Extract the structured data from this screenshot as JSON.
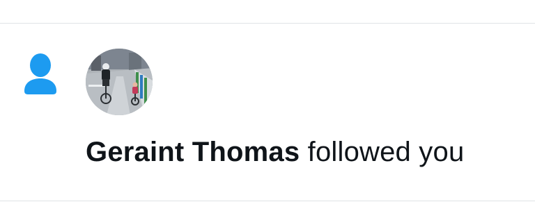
{
  "notification": {
    "type_icon": "person-icon",
    "accent_color": "#1d9bf0",
    "avatar": "user-avatar",
    "user_name": "Geraint Thomas",
    "action_text": "followed you"
  }
}
